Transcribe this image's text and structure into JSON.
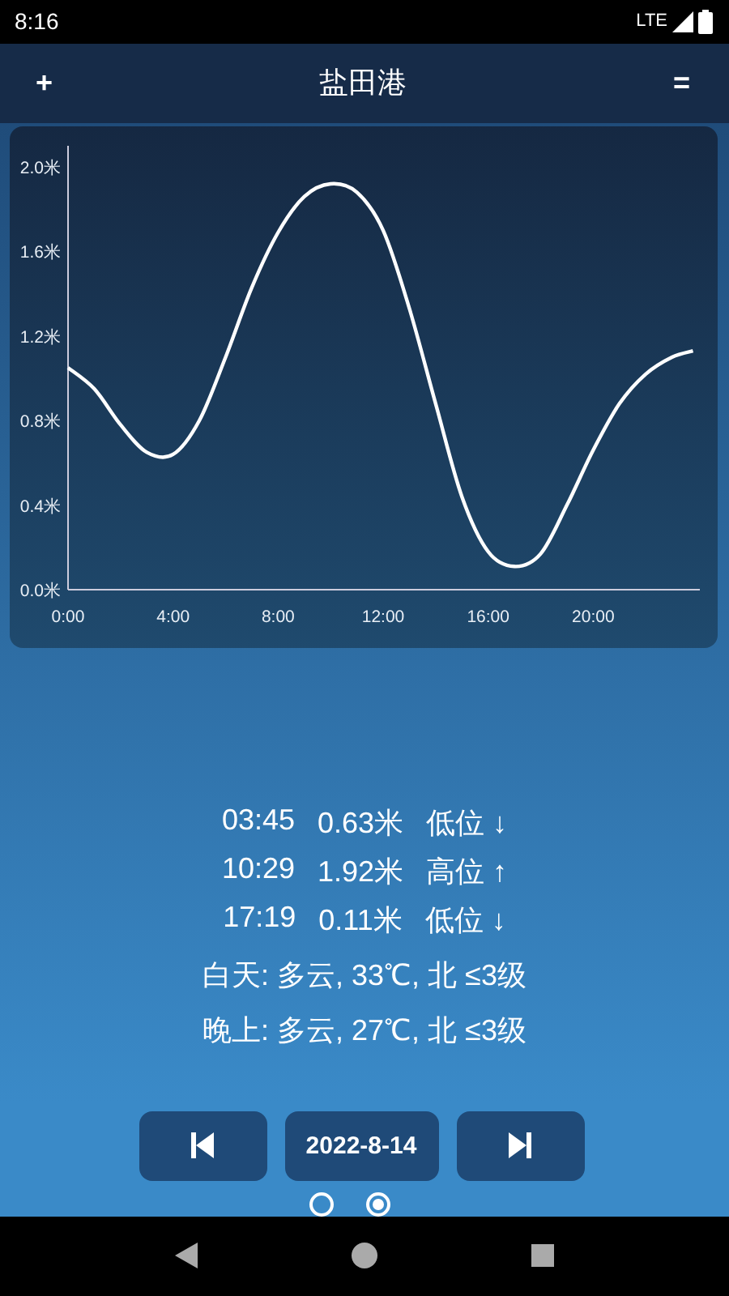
{
  "status_bar": {
    "time": "8:16",
    "network": "LTE"
  },
  "header": {
    "add_button": "+",
    "title": "盐田港",
    "menu_button": "="
  },
  "chart_data": {
    "type": "line",
    "xlim": [
      0,
      24
    ],
    "ylim": [
      0,
      2.1
    ],
    "xticks": [
      {
        "value": 0,
        "label": "0:00"
      },
      {
        "value": 4,
        "label": "4:00"
      },
      {
        "value": 8,
        "label": "8:00"
      },
      {
        "value": 12,
        "label": "12:00"
      },
      {
        "value": 16,
        "label": "16:00"
      },
      {
        "value": 20,
        "label": "20:00"
      }
    ],
    "yticks": [
      {
        "value": 0,
        "label": "0.0米"
      },
      {
        "value": 0.4,
        "label": "0.4米"
      },
      {
        "value": 0.8,
        "label": "0.8米"
      },
      {
        "value": 1.2,
        "label": "1.2米"
      },
      {
        "value": 1.6,
        "label": "1.6米"
      },
      {
        "value": 2.0,
        "label": "2.0米"
      }
    ],
    "x": [
      0,
      1,
      2,
      3,
      4,
      5,
      6,
      7,
      8,
      9,
      10,
      11,
      12,
      13,
      14,
      15,
      16,
      17,
      18,
      19,
      20,
      21,
      22,
      23,
      23.8
    ],
    "series": [
      {
        "color": "#ffffff",
        "values": [
          1.05,
          0.95,
          0.78,
          0.65,
          0.64,
          0.8,
          1.1,
          1.43,
          1.69,
          1.86,
          1.92,
          1.88,
          1.7,
          1.33,
          0.88,
          0.44,
          0.18,
          0.11,
          0.17,
          0.4,
          0.66,
          0.88,
          1.02,
          1.1,
          1.13
        ]
      }
    ]
  },
  "tides": [
    {
      "time": "03:45",
      "height": "0.63米",
      "label": "低位",
      "arrow": "↓"
    },
    {
      "time": "10:29",
      "height": "1.92米",
      "label": "高位",
      "arrow": "↑"
    },
    {
      "time": "17:19",
      "height": "0.11米",
      "label": "低位",
      "arrow": "↓"
    }
  ],
  "weather": [
    "白天: 多云, 33℃, 北 ≤3级",
    "晚上: 多云, 27℃, 北 ≤3级"
  ],
  "date_button": "2022-8-14",
  "pages": [
    {
      "selected": false
    },
    {
      "selected": true
    }
  ]
}
